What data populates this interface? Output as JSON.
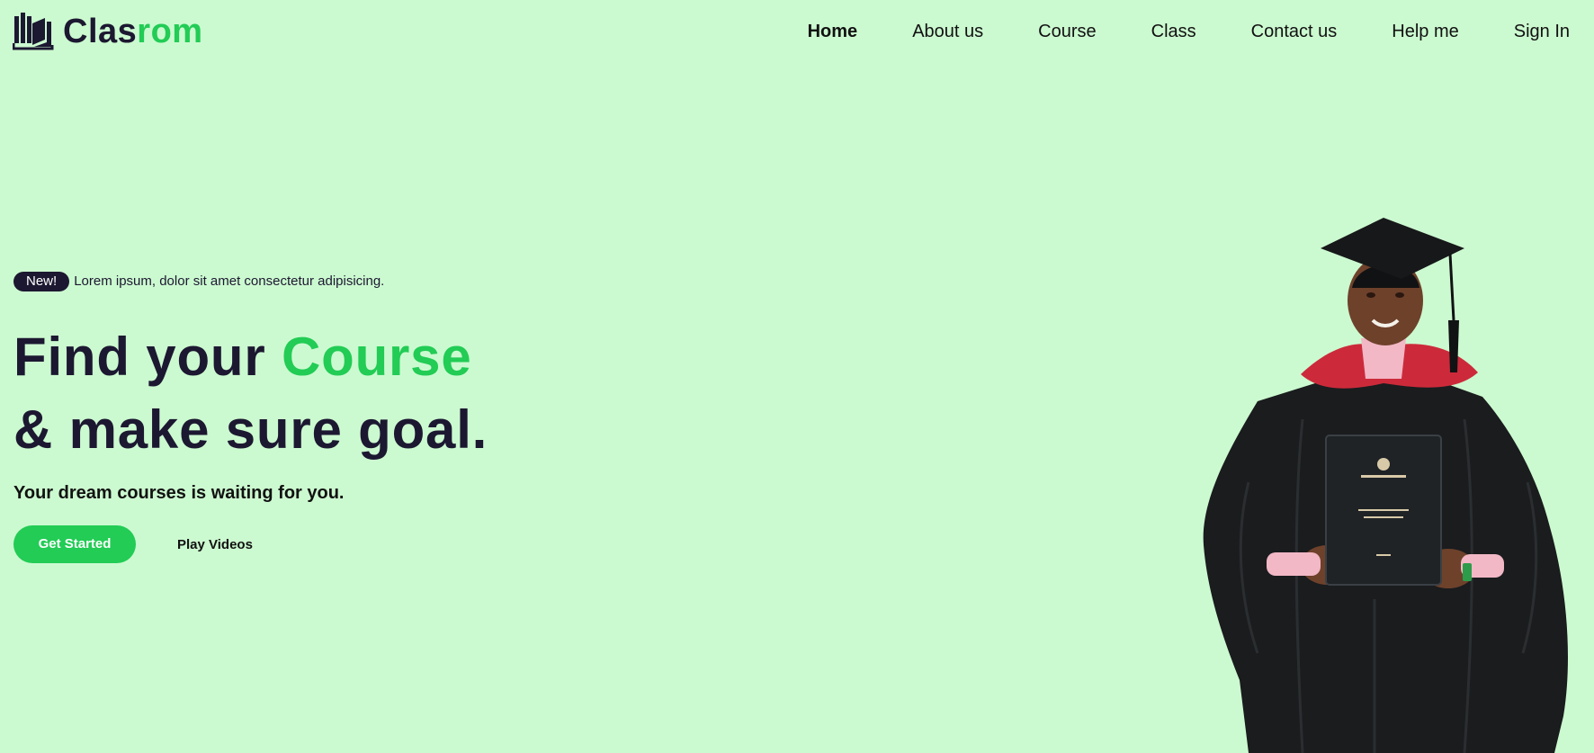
{
  "brand": {
    "name_part1": "Clas",
    "name_part2": "rom",
    "icon": "open-book-icon",
    "colors": {
      "dark": "#1c1831",
      "accent": "#22cc55"
    }
  },
  "nav": {
    "items": [
      {
        "label": "Home",
        "active": true
      },
      {
        "label": "About us"
      },
      {
        "label": "Course"
      },
      {
        "label": "Class"
      },
      {
        "label": "Contact us"
      },
      {
        "label": "Help me"
      },
      {
        "label": "Sign In"
      }
    ]
  },
  "hero": {
    "badge": "New!",
    "announcement": "Lorem ipsum, dolor sit amet consectetur adipisicing.",
    "headline_part1": "Find your ",
    "headline_accent": "Course",
    "headline_line2": "& make sure goal.",
    "subtitle": "Your dream courses is waiting for you.",
    "primary_button": "Get Started",
    "secondary_button": "Play Videos",
    "image": "graduate-photo"
  },
  "theme": {
    "background": "#ccfad0",
    "accent": "#22cc55",
    "dark": "#1c1831"
  }
}
